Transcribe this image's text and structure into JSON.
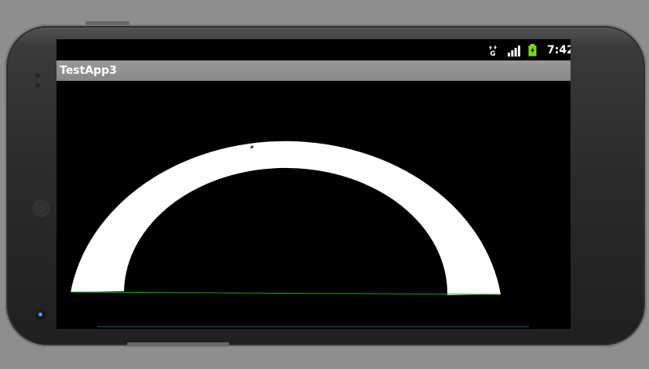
{
  "device": {
    "status_bar": {
      "time": "7:42",
      "network_type": "G",
      "signal_icon": "signal-bars-icon",
      "battery_icon": "battery-charging-icon",
      "data_icon": "mobile-data-icon"
    },
    "app_title": "TestApp3"
  },
  "drawing": {
    "shape": "white semicircular arc",
    "stroke_color": "#ffffff",
    "background_color": "#000000",
    "baseline_color": "#16a316",
    "navigation_line_color": "#1f4f94"
  },
  "colors": {
    "device_frame": "#2a2a2a",
    "screen_background": "#000000",
    "title_bar": "#8f8f8f",
    "battery_green": "#7ddc1f"
  }
}
